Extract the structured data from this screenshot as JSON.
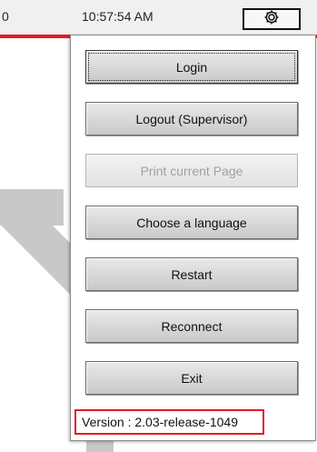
{
  "topbar": {
    "left_text": "0",
    "clock": "10:57:54 AM",
    "settings_icon": "gear-icon"
  },
  "menu": {
    "items": [
      {
        "label": "Login",
        "state": "focused"
      },
      {
        "label": "Logout (Supervisor)",
        "state": "enabled"
      },
      {
        "label": "Print current Page",
        "state": "disabled"
      },
      {
        "label": "Choose a language",
        "state": "enabled"
      },
      {
        "label": "Restart",
        "state": "enabled"
      },
      {
        "label": "Reconnect",
        "state": "enabled"
      },
      {
        "label": "Exit",
        "state": "enabled"
      }
    ],
    "version": "Version : 2.03-release-1049"
  },
  "colors": {
    "accent_red": "#e31b23",
    "background_shape": "#c8c8c8"
  }
}
